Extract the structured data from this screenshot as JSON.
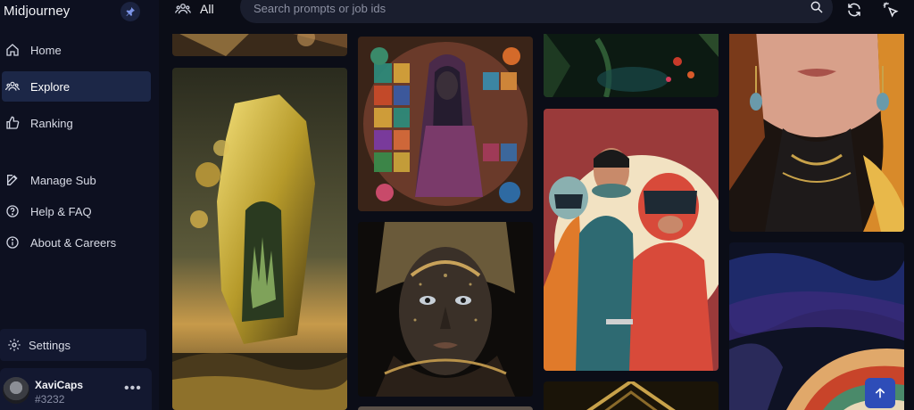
{
  "app": {
    "title": "Midjourney"
  },
  "sidebar": {
    "items": [
      {
        "label": "Home",
        "icon": "home-icon"
      },
      {
        "label": "Explore",
        "icon": "people-icon",
        "active": true
      },
      {
        "label": "Ranking",
        "icon": "thumbs-up-icon"
      },
      {
        "label": "Manage Sub",
        "icon": "edit-icon"
      },
      {
        "label": "Help & FAQ",
        "icon": "help-circle-icon"
      },
      {
        "label": "About & Careers",
        "icon": "info-circle-icon"
      }
    ],
    "settings": {
      "label": "Settings",
      "icon": "gear-icon"
    },
    "user": {
      "name": "XaviCaps",
      "tag": "#3232"
    }
  },
  "topbar": {
    "filter_label": "All",
    "search": {
      "placeholder": "Search prompts or job ids",
      "value": ""
    }
  },
  "colors": {
    "background": "#0b0d17",
    "sidebar": "#0d1020",
    "active_item": "#1c2747",
    "accent": "#2e4db8"
  },
  "gallery": {
    "items": [
      {
        "name": "tile-partial-top-left"
      },
      {
        "name": "tile-crystal-portal"
      },
      {
        "name": "tile-stained-glass-woman"
      },
      {
        "name": "tile-golden-face"
      },
      {
        "name": "tile-partial-bottom-col2"
      },
      {
        "name": "tile-dark-jungle"
      },
      {
        "name": "tile-retro-astronauts"
      },
      {
        "name": "tile-partial-bottom-col3"
      },
      {
        "name": "tile-woman-earrings"
      },
      {
        "name": "tile-swirl-abstract"
      }
    ]
  }
}
